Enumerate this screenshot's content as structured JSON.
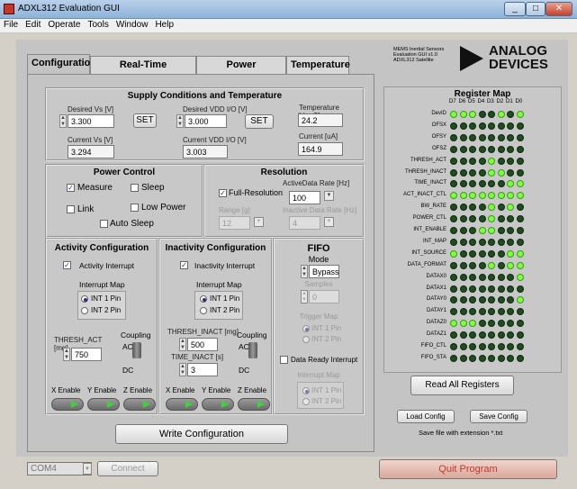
{
  "window": {
    "title": "ADXL312 Evaluation GUI"
  },
  "menu": [
    "File",
    "Edit",
    "Operate",
    "Tools",
    "Window",
    "Help"
  ],
  "tabs": [
    "Configuration",
    "Real-Time Measurement",
    "Power Consumption",
    "Temperature"
  ],
  "info": {
    "line1": "MEMS Inertial Sensors",
    "line2": "Evaluation GUI v1.0",
    "line3": "ADXL312 Satellite"
  },
  "logo": {
    "line1": "ANALOG",
    "line2": "DEVICES"
  },
  "supply": {
    "title": "Supply Conditions and Temperature",
    "desired_vs_label": "Desired Vs [V]",
    "desired_vs": "3.300",
    "set1": "SET",
    "desired_vdd_label": "Desired VDD I/O [V]",
    "desired_vdd": "3.000",
    "set2": "SET",
    "temp_label": "Temperature [degC]",
    "temp": "24.2",
    "current_vs_label": "Current Vs [V]",
    "current_vs": "3.294",
    "current_vdd_label": "Current VDD I/O [V]",
    "current_vdd": "3.003",
    "current_label": "Current [uA]",
    "current": "164.9"
  },
  "power": {
    "title": "Power Control",
    "measure": "Measure",
    "sleep": "Sleep",
    "link": "Link",
    "low_power": "Low Power",
    "auto_sleep": "Auto Sleep"
  },
  "resolution": {
    "title": "Resolution",
    "full_res": "Full-Resolution",
    "active_rate_label": "ActiveData Rate [Hz]",
    "active_rate": "100",
    "range_label": "Range [g]",
    "range": "12",
    "inactive_rate_label": "Inactive Data Rate [Hz]",
    "inactive_rate": "4"
  },
  "activity": {
    "title": "Activity Configuration",
    "interrupt": "Activity Interrupt",
    "map_label": "Interrupt Map",
    "int1": "INT 1 Pin",
    "int2": "INT 2 Pin",
    "thresh_label": "THRESH_ACT [mg]",
    "thresh": "750",
    "coupling": "Coupling",
    "ac": "AC",
    "dc": "DC",
    "xen": "X Enable",
    "yen": "Y Enable",
    "zen": "Z Enable"
  },
  "inactivity": {
    "title": "Inactivity Configuration",
    "interrupt": "Inactivity Interrupt",
    "map_label": "Interrupt Map",
    "int1": "INT 1 Pin",
    "int2": "INT 2 Pin",
    "thresh_label": "THRESH_INACT [mg]",
    "thresh": "500",
    "time_label": "TIME_INACT [s]",
    "time": "3",
    "coupling": "Coupling",
    "ac": "AC",
    "dc": "DC",
    "xen": "X Enable",
    "yen": "Y Enable",
    "zen": "Z Enable"
  },
  "fifo": {
    "title": "FIFO",
    "mode_label": "Mode",
    "mode": "Bypass",
    "samples_label": "Samples",
    "samples": "0",
    "trigger_label": "Trigger Map",
    "int1": "INT 1 Pin",
    "int2": "INT 2 Pin",
    "data_ready": "Data Ready Interrupt",
    "int_map_label": "Interrupt Map",
    "dr_int1": "INT 1 Pin",
    "dr_int2": "INT 2 Pin"
  },
  "write_button": "Write Configuration",
  "register_map": {
    "title": "Register Map",
    "bits": [
      "D7",
      "D6",
      "D5",
      "D4",
      "D3",
      "D2",
      "D1",
      "D0"
    ],
    "rows": [
      {
        "name": "DevID",
        "bits": [
          1,
          1,
          1,
          0,
          0,
          1,
          0,
          1
        ]
      },
      {
        "name": "OFSX",
        "bits": [
          0,
          0,
          0,
          0,
          0,
          0,
          0,
          0
        ]
      },
      {
        "name": "OFSY",
        "bits": [
          0,
          0,
          0,
          0,
          0,
          0,
          0,
          0
        ]
      },
      {
        "name": "OFSZ",
        "bits": [
          0,
          0,
          0,
          0,
          0,
          0,
          0,
          0
        ]
      },
      {
        "name": "THRESH_ACT",
        "bits": [
          0,
          0,
          0,
          0,
          1,
          0,
          0,
          0
        ]
      },
      {
        "name": "THRESH_INACT",
        "bits": [
          0,
          0,
          0,
          0,
          1,
          1,
          0,
          0
        ]
      },
      {
        "name": "TIME_INACT",
        "bits": [
          0,
          0,
          0,
          0,
          0,
          0,
          1,
          1
        ]
      },
      {
        "name": "ACT_INACT_CTL",
        "bits": [
          1,
          1,
          1,
          1,
          1,
          1,
          1,
          1
        ]
      },
      {
        "name": "BW_RATE",
        "bits": [
          0,
          0,
          0,
          0,
          1,
          0,
          1,
          0
        ]
      },
      {
        "name": "POWER_CTL",
        "bits": [
          0,
          0,
          0,
          0,
          1,
          0,
          0,
          0
        ]
      },
      {
        "name": "INT_ENABLE",
        "bits": [
          0,
          0,
          0,
          1,
          1,
          0,
          0,
          0
        ]
      },
      {
        "name": "INT_MAP",
        "bits": [
          0,
          0,
          0,
          0,
          0,
          0,
          0,
          0
        ]
      },
      {
        "name": "INT_SOURCE",
        "bits": [
          1,
          0,
          0,
          0,
          0,
          0,
          1,
          1
        ]
      },
      {
        "name": "DATA_FORMAT",
        "bits": [
          0,
          0,
          0,
          0,
          1,
          0,
          1,
          1
        ]
      },
      {
        "name": "DATAX0",
        "bits": [
          0,
          0,
          0,
          0,
          0,
          0,
          0,
          1
        ]
      },
      {
        "name": "DATAX1",
        "bits": [
          0,
          0,
          0,
          0,
          0,
          0,
          0,
          0
        ]
      },
      {
        "name": "DATAY0",
        "bits": [
          0,
          0,
          0,
          0,
          0,
          0,
          0,
          1
        ]
      },
      {
        "name": "DATAY1",
        "bits": [
          0,
          0,
          0,
          0,
          0,
          0,
          0,
          0
        ]
      },
      {
        "name": "DATAZ0",
        "bits": [
          1,
          1,
          1,
          0,
          0,
          0,
          0,
          0
        ]
      },
      {
        "name": "DATAZ1",
        "bits": [
          0,
          0,
          0,
          0,
          0,
          0,
          0,
          0
        ]
      },
      {
        "name": "FIFO_CTL",
        "bits": [
          0,
          0,
          0,
          0,
          0,
          0,
          0,
          0
        ]
      },
      {
        "name": "FIFO_STA",
        "bits": [
          0,
          0,
          0,
          0,
          0,
          0,
          0,
          0
        ]
      }
    ]
  },
  "read_all": "Read All Registers",
  "load_config": "Load Config",
  "save_config": "Save Config",
  "save_note": "Save file with extension *.txt",
  "port": "COM4",
  "connect": "Connect",
  "quit": "Quit Program"
}
